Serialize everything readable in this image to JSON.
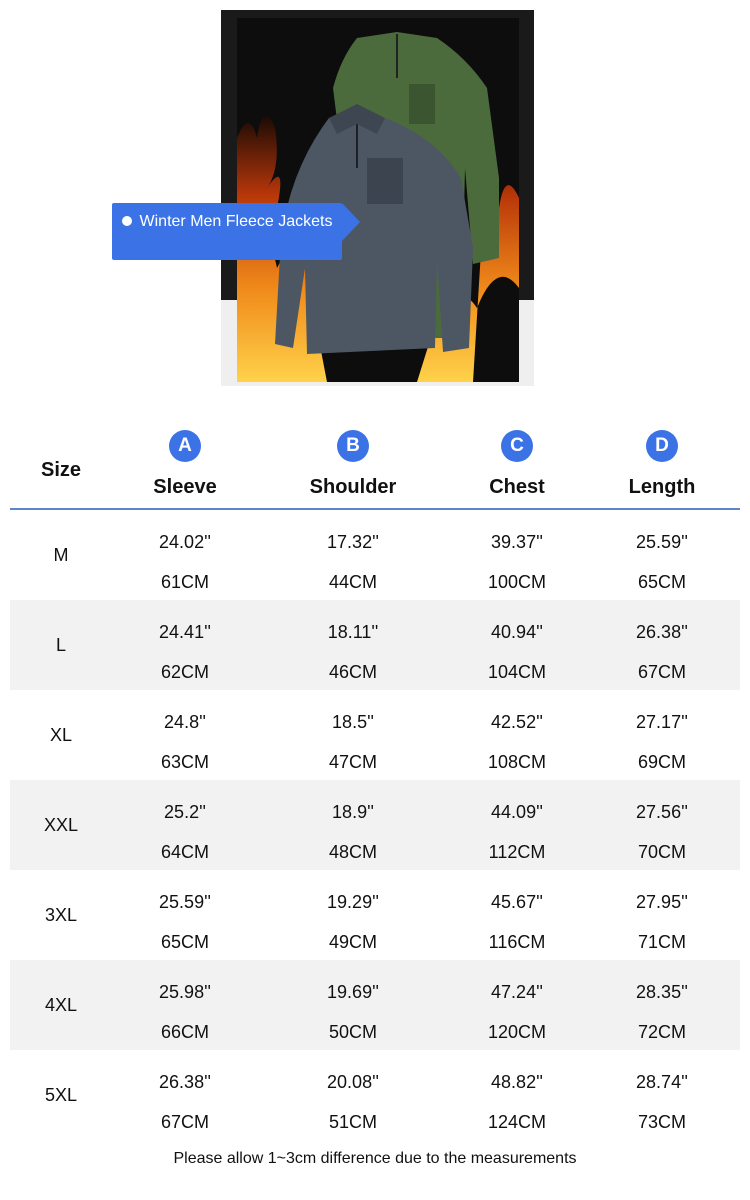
{
  "product": {
    "badge_text": "Winter Men Fleece Jackets"
  },
  "table": {
    "size_header": "Size",
    "columns": [
      {
        "letter": "A",
        "label": "Sleeve"
      },
      {
        "letter": "B",
        "label": "Shoulder"
      },
      {
        "letter": "C",
        "label": "Chest"
      },
      {
        "letter": "D",
        "label": "Length"
      }
    ],
    "rows": [
      {
        "size": "M",
        "values": [
          [
            "24.02''",
            "61CM"
          ],
          [
            "17.32''",
            "44CM"
          ],
          [
            "39.37''",
            "100CM"
          ],
          [
            "25.59''",
            "65CM"
          ]
        ]
      },
      {
        "size": "L",
        "values": [
          [
            "24.41''",
            "62CM"
          ],
          [
            "18.11''",
            "46CM"
          ],
          [
            "40.94''",
            "104CM"
          ],
          [
            "26.38''",
            "67CM"
          ]
        ]
      },
      {
        "size": "XL",
        "values": [
          [
            "24.8''",
            "63CM"
          ],
          [
            "18.5''",
            "47CM"
          ],
          [
            "42.52''",
            "108CM"
          ],
          [
            "27.17''",
            "69CM"
          ]
        ]
      },
      {
        "size": "XXL",
        "values": [
          [
            "25.2''",
            "64CM"
          ],
          [
            "18.9''",
            "48CM"
          ],
          [
            "44.09''",
            "112CM"
          ],
          [
            "27.56''",
            "70CM"
          ]
        ]
      },
      {
        "size": "3XL",
        "values": [
          [
            "25.59''",
            "65CM"
          ],
          [
            "19.29''",
            "49CM"
          ],
          [
            "45.67''",
            "116CM"
          ],
          [
            "27.95''",
            "71CM"
          ]
        ]
      },
      {
        "size": "4XL",
        "values": [
          [
            "25.98''",
            "66CM"
          ],
          [
            "19.69''",
            "50CM"
          ],
          [
            "47.24''",
            "120CM"
          ],
          [
            "28.35''",
            "72CM"
          ]
        ]
      },
      {
        "size": "5XL",
        "values": [
          [
            "26.38''",
            "67CM"
          ],
          [
            "20.08''",
            "51CM"
          ],
          [
            "48.82''",
            "124CM"
          ],
          [
            "28.74''",
            "73CM"
          ]
        ]
      }
    ]
  },
  "footer": {
    "note": "Please allow 1~3cm difference due to the measurements"
  },
  "colors": {
    "accent": "#3b73e6",
    "divider": "#5b86c7",
    "row_shade": "#f2f2f2"
  }
}
